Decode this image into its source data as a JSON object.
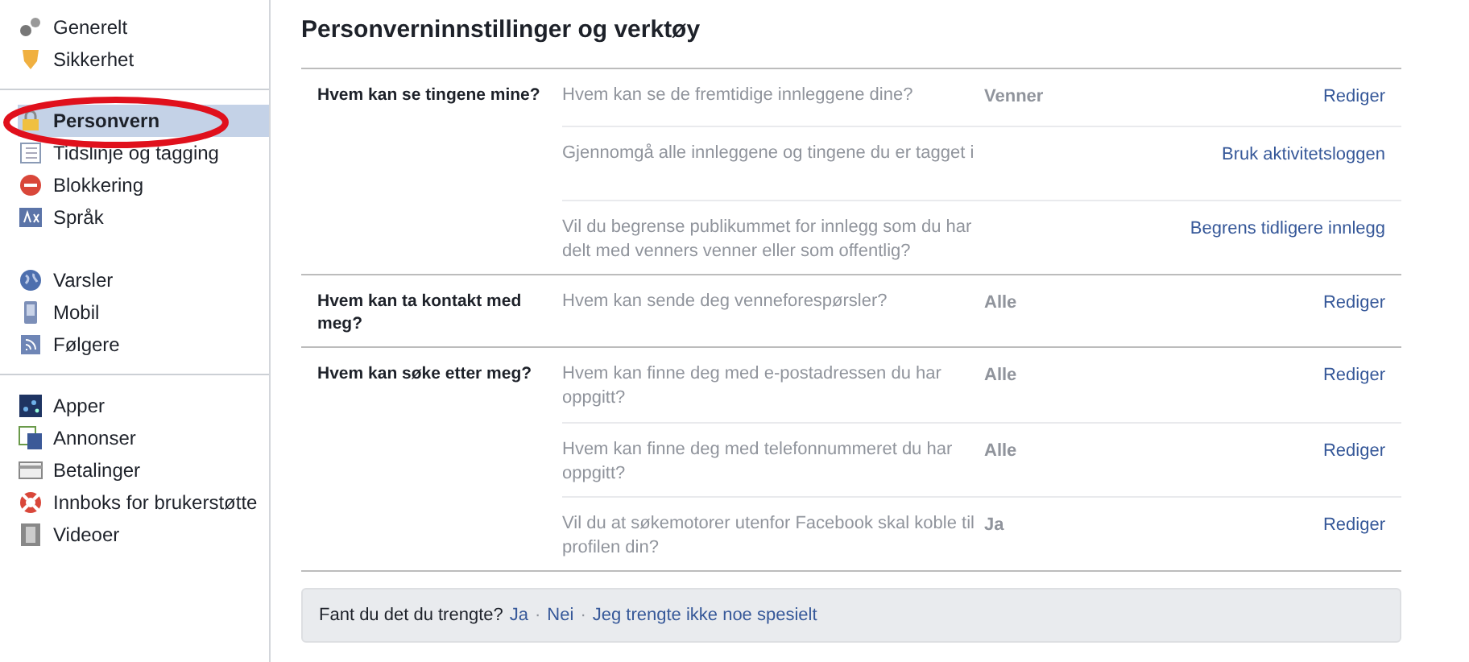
{
  "sidebar": {
    "sections": [
      {
        "items": [
          {
            "label": "Generelt",
            "selected": false
          },
          {
            "label": "Sikkerhet",
            "selected": false
          }
        ]
      },
      {
        "divider": true,
        "items": [
          {
            "label": "Personvern",
            "selected": true
          },
          {
            "label": "Tidslinje og tagging",
            "selected": false
          },
          {
            "label": "Blokkering",
            "selected": false
          },
          {
            "label": "Språk",
            "selected": false
          }
        ]
      },
      {
        "divider": false,
        "items": [
          {
            "label": "Varsler",
            "selected": false
          },
          {
            "label": "Mobil",
            "selected": false
          },
          {
            "label": "Følgere",
            "selected": false
          }
        ]
      },
      {
        "divider": true,
        "items": [
          {
            "label": "Apper",
            "selected": false
          },
          {
            "label": "Annonser",
            "selected": false
          },
          {
            "label": "Betalinger",
            "selected": false
          },
          {
            "label": "Innboks for brukerstøtte",
            "selected": false
          },
          {
            "label": "Videoer",
            "selected": false
          }
        ]
      }
    ]
  },
  "title": "Personverninnstillinger og verktøy",
  "sections": [
    {
      "label": "Hvem kan se tingene mine?",
      "rows": [
        {
          "question": "Hvem kan se de fremtidige innleggene dine?",
          "value": "Venner",
          "action": "Rediger"
        },
        {
          "question": "Gjennomgå alle innleggene og tingene du er tagget i",
          "action": "Bruk aktivitetsloggen"
        },
        {
          "question": "Vil du begrense publikummet for innlegg som du har delt med venners venner eller som offentlig?",
          "action": "Begrens tidligere innlegg"
        }
      ]
    },
    {
      "label": "Hvem kan ta kontakt med meg?",
      "rows": [
        {
          "question": "Hvem kan sende deg venneforespørsler?",
          "value": "Alle",
          "action": "Rediger"
        }
      ]
    },
    {
      "label": "Hvem kan søke etter meg?",
      "rows": [
        {
          "question": "Hvem kan finne deg med e-postadressen du har oppgitt?",
          "value": "Alle",
          "action": "Rediger"
        },
        {
          "question": "Hvem kan finne deg med telefonnummeret du har oppgitt?",
          "value": "Alle",
          "action": "Rediger"
        },
        {
          "question": "Vil du at søkemotorer utenfor Facebook skal koble til profilen din?",
          "value": "Ja",
          "action": "Rediger"
        }
      ]
    }
  ],
  "feedback": {
    "question": "Fant du det du trengte?",
    "separator": "·",
    "links": [
      "Ja",
      "Nei",
      "Jeg trengte ikke noe spesielt"
    ]
  }
}
